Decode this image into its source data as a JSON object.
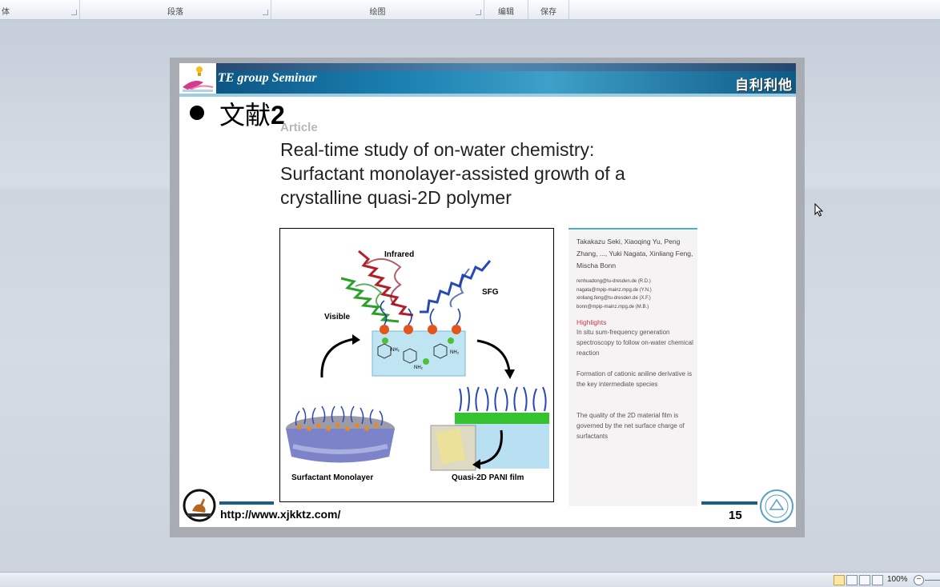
{
  "ribbon": {
    "groups": [
      {
        "label": "体"
      },
      {
        "label": "段落"
      },
      {
        "label": "绘图"
      },
      {
        "label": "编辑"
      },
      {
        "label": "保存"
      }
    ]
  },
  "slide": {
    "banner_title": "TE group Seminar",
    "banner_right": "自利利他",
    "heading_cn": "文献",
    "heading_num": "2",
    "article_label": "Article",
    "title_lines": [
      "Real-time study of on-water chemistry:",
      "Surfactant monolayer-assisted growth of a",
      "crystalline quasi-2D polymer"
    ],
    "figure": {
      "labels": {
        "infrared": "Infrared",
        "sfg": "SFG",
        "visible": "Visible",
        "nh2": "NH₂",
        "surfactant": "Surfactant Monolayer",
        "pani": "Quasi-2D PANI film"
      }
    },
    "side_panel": {
      "authors": "Takakazu Seki, Xiaoqing Yu, Peng Zhang, ..., Yuki Nagata, Xinliang Feng, Mischa Bonn",
      "emails": [
        "renhuadong@tu-dresden.de (R.D.)",
        "nagata@mpip-mainz.mpg.de (Y.N.)",
        "xinliang.feng@tu-dresden.de (X.F.)",
        "bonn@mpip-mainz.mpg.de (M.B.)"
      ],
      "highlights_title": "Highlights",
      "highlights": [
        "In situ sum-frequency generation spectroscopy to follow on-water chemical reaction",
        "Formation of cationic aniline derivative is the key intermediate species",
        "The quality of the 2D material film is governed by the net surface charge of surfactants"
      ]
    },
    "footer_url": "http://www.xjkktz.com/",
    "page_number": "15"
  },
  "statusbar": {
    "zoom": "100%",
    "minus": "−"
  },
  "colors": {
    "banner_dark": "#0a4d7a",
    "banner_light": "#3ea0c8",
    "highlight_red": "#c03a45",
    "panel_accent": "#4ab0cf"
  }
}
